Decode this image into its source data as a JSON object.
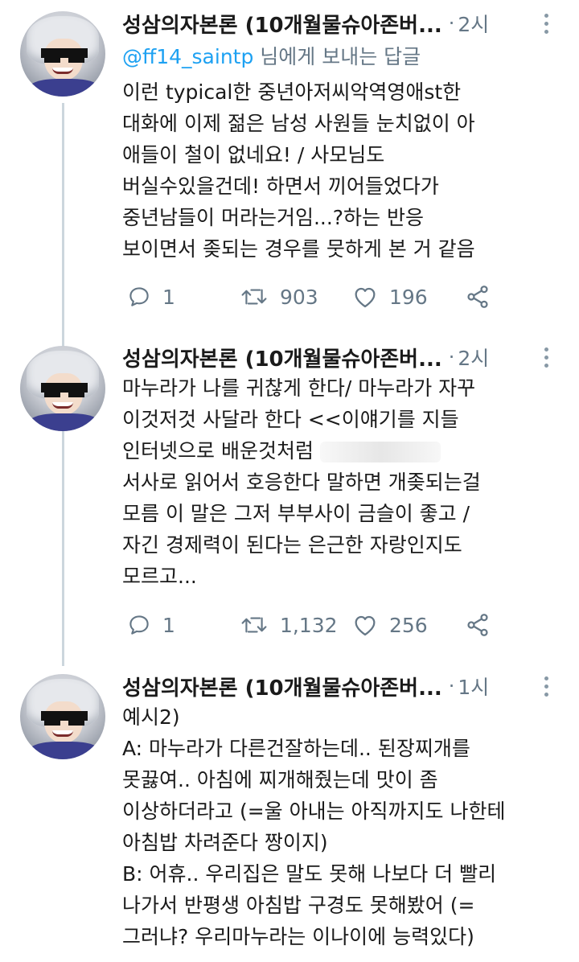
{
  "tweets": [
    {
      "author": "성삼의자본론 (10개월물슈아존버...",
      "time": "2시",
      "reply_prefix": "@ff14_saintp",
      "reply_suffix": " 님에게 보내는 답글",
      "lines": [
        "이런 typical한 중년아저씨악역영애st한",
        "대화에 이제 젊은 남성 사원들 눈치없이 아",
        "애들이 철이 없네요! / 사모님도",
        "버실수있을건데! 하면서 끼어들었다가",
        "중년남들이 머라는거임...?하는 반응",
        "보이면서 좆되는 경우를 뭇하게 본 거 같음"
      ],
      "replies": "1",
      "retweets": "903",
      "likes": "196"
    },
    {
      "author": "성삼의자본론 (10개월물슈아존버...",
      "time": "2시",
      "lines": [
        "마누라가 나를 귀찮게 한다/ 마누라가 자꾸",
        "이것저것 사달라 한다 <<이얘기를 지들",
        "인터넷으로 배운것처럼",
        "서사로 읽어서 호응한다 말하면 개좆되는걸",
        "모름 이 말은 그저 부부사이 금슬이 좋고 /",
        "자긴 경제력이 된다는 은근한 자랑인지도",
        "모르고..."
      ],
      "replies": "1",
      "retweets": "1,132",
      "likes": "256"
    },
    {
      "author": "성삼의자본론 (10개월물슈아존버...",
      "time": "1시",
      "lines": [
        "예시2)",
        "A: 마누라가 다른건잘하는데.. 된장찌개를",
        "못끓여.. 아침에 찌개해줬는데 맛이 좀",
        "이상하더라고 (=울 아내는 아직까지도 나한테",
        "아침밥 차려준다 짱이지)",
        "B: 어휴.. 우리집은 말도 못해 나보다 더 빨리",
        "나가서 반평생 아침밥 구경도 못해봤어 (=",
        "그러냐? 우리마누라는 이나이에 능력있다)"
      ]
    }
  ],
  "icons": {
    "reply": "reply-bubble-icon",
    "retweet": "retweet-arrows-icon",
    "like": "heart-icon",
    "share": "share-icon",
    "more": "more-vertical-icon"
  },
  "colors": {
    "text": "#1a1a1a",
    "muted": "#657786",
    "link": "#1da1f2",
    "thread_line": "#ccd6dd"
  }
}
